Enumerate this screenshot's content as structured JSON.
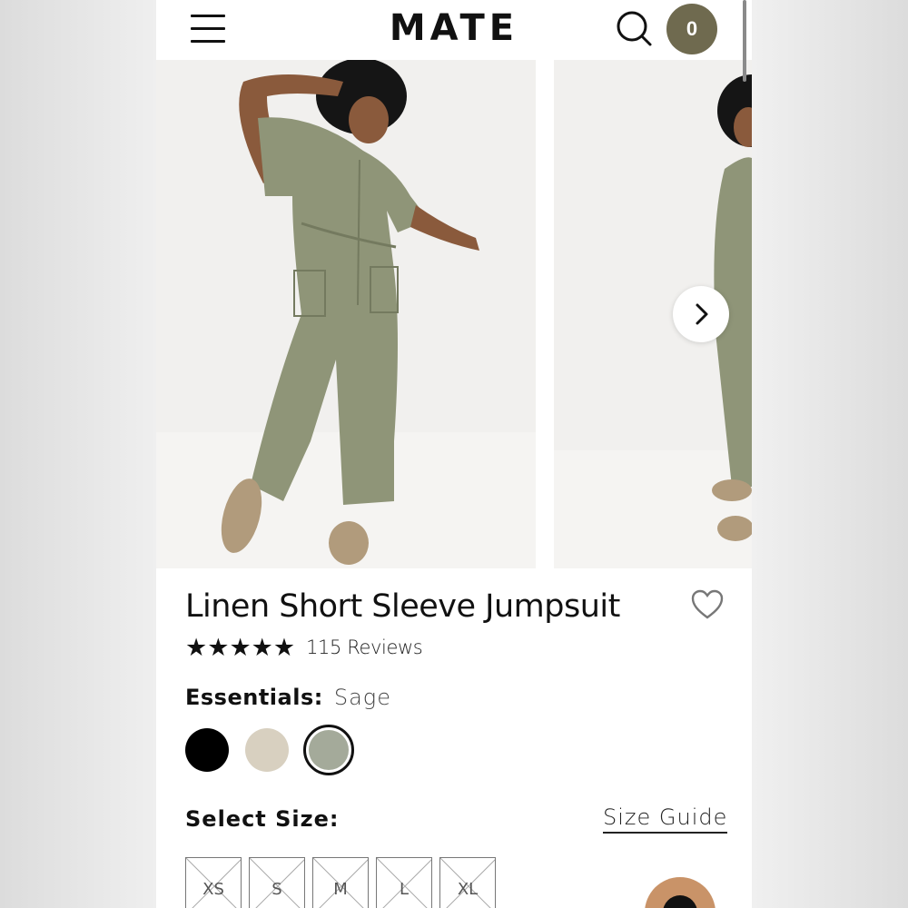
{
  "header": {
    "logo": "MATE",
    "cart_count": "0"
  },
  "product": {
    "title": "Linen Short Sleeve Jumpsuit",
    "rating": 5,
    "reviews_label": "115 Reviews",
    "color_label": "Essentials:",
    "color_value": "Sage",
    "swatches": [
      {
        "name": "Black",
        "color": "#000000",
        "selected": false
      },
      {
        "name": "Natural",
        "color": "#d8d0c0",
        "selected": false
      },
      {
        "name": "Sage",
        "color": "#a4aa9a",
        "selected": true
      }
    ],
    "size_label": "Select Size:",
    "size_guide_label": "Size Guide",
    "sizes": [
      "XS",
      "S",
      "M",
      "L",
      "XL"
    ],
    "sizes_unavailable": true
  },
  "colors": {
    "accent_olive": "#6f6a4f",
    "garment_sage": "#8f9578",
    "chat_button": "#c99368"
  },
  "icons": {
    "menu": "hamburger-icon",
    "search": "search-icon",
    "favorite": "heart-outline-icon",
    "next": "chevron-right-icon",
    "star": "star-icon"
  }
}
